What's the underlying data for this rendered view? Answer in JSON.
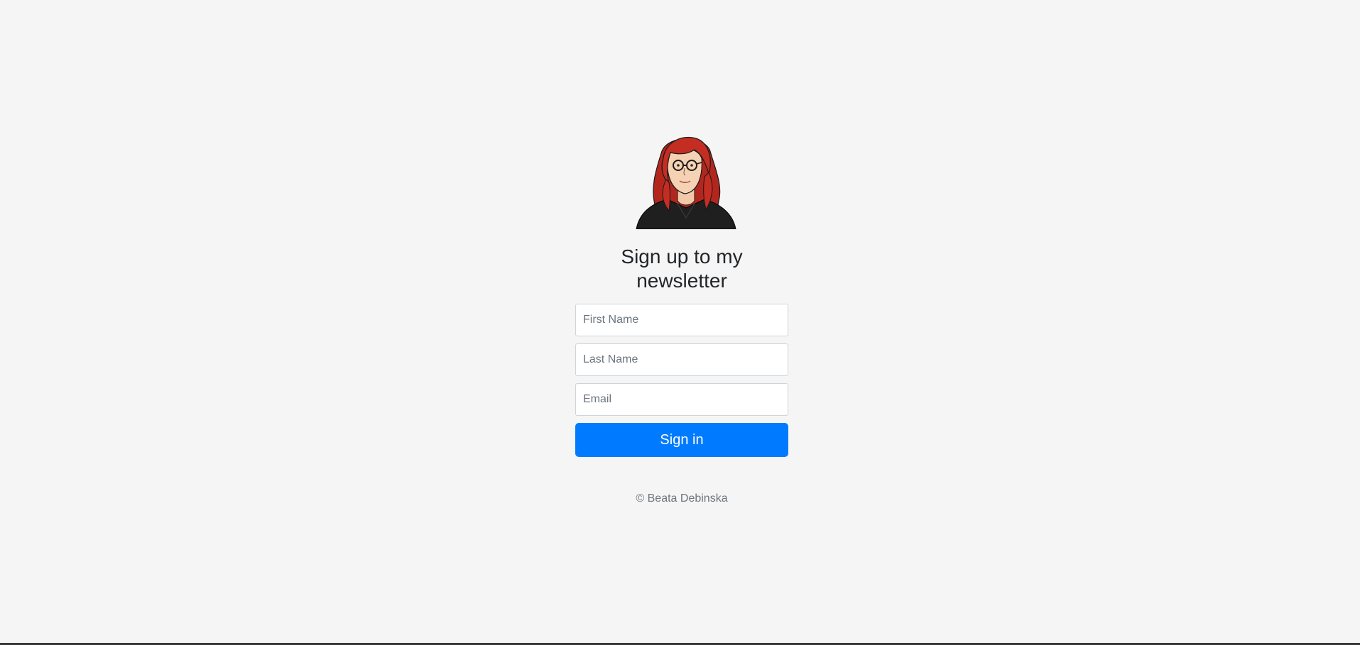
{
  "newsletter": {
    "heading": "Sign up to my newsletter",
    "avatar_icon": "woman-red-hair-glasses-avatar-icon",
    "fields": {
      "first_name_placeholder": "First Name",
      "last_name_placeholder": "Last Name",
      "email_placeholder": "Email"
    },
    "submit_label": "Sign in",
    "copyright": "© Beata Debinska"
  },
  "colors": {
    "background": "#f5f5f5",
    "primary": "#007bff",
    "muted_text": "#6c757d"
  }
}
